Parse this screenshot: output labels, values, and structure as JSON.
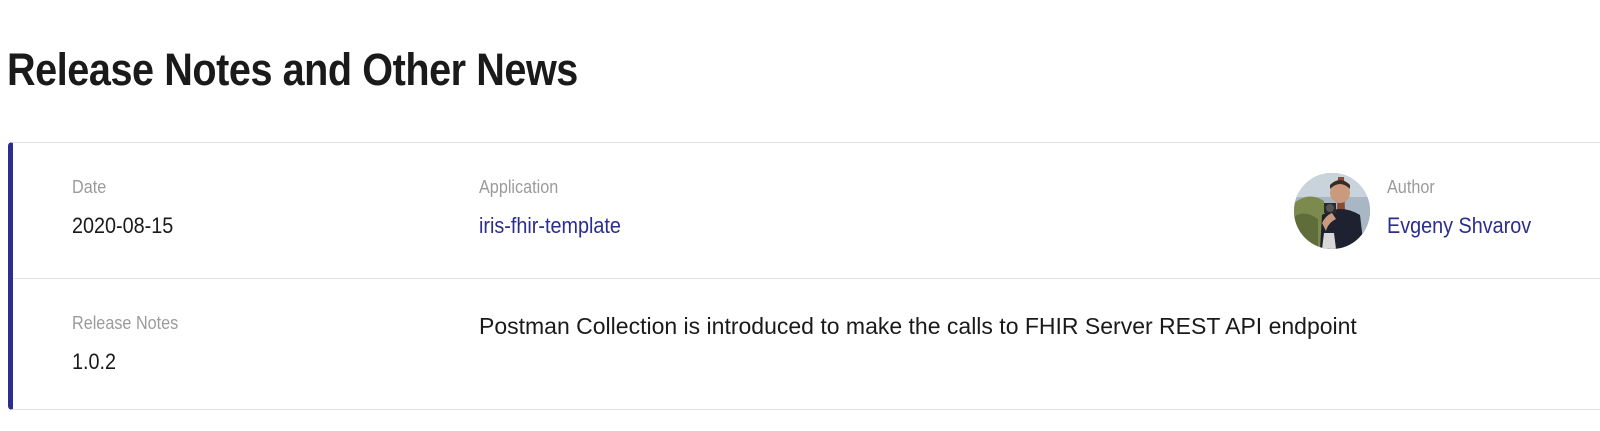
{
  "page": {
    "title": "Release Notes and Other News"
  },
  "release": {
    "date_label": "Date",
    "date_value": "2020-08-15",
    "application_label": "Application",
    "application_value": "iris-fhir-template",
    "author_label": "Author",
    "author_value": "Evgeny Shvarov",
    "notes_label": "Release Notes",
    "notes_version": "1.0.2",
    "notes_text": "Postman Collection is introduced to make the calls to FHIR Server REST API endpoint"
  },
  "colors": {
    "accent": "#2b2d8f",
    "label": "#9b9b9b",
    "divider": "#e3e3e3"
  },
  "icons": {
    "avatar": "author-avatar-photo"
  }
}
